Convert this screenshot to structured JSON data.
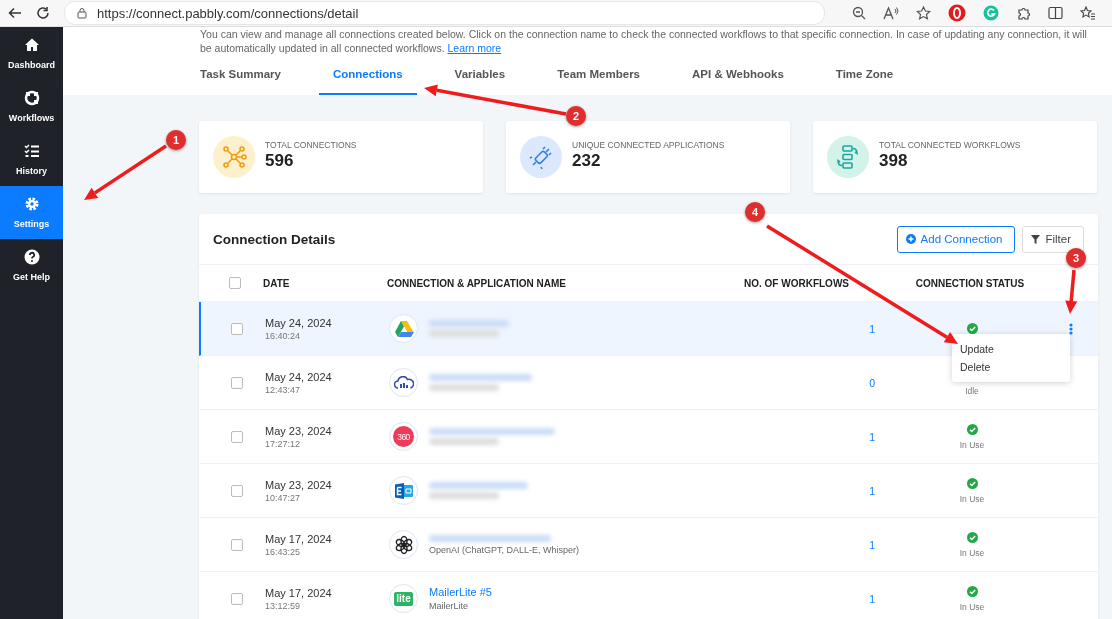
{
  "browser": {
    "url": "https://connect.pabbly.com/connections/detail"
  },
  "sidebar": {
    "items": [
      {
        "label": "Dashboard",
        "selected": false
      },
      {
        "label": "Workflows",
        "selected": false
      },
      {
        "label": "History",
        "selected": false
      },
      {
        "label": "Settings",
        "selected": true
      },
      {
        "label": "Get Help",
        "selected": false
      }
    ]
  },
  "header": {
    "description": "You can view and manage all connections created below. Click on the connection name to check the connected workflows to that specific connection. In case of updating any connection, it will be automatically updated in all connected workflows.",
    "link": "Learn more"
  },
  "tabs": [
    {
      "label": "Task Summary",
      "selected": false
    },
    {
      "label": "Connections",
      "selected": true
    },
    {
      "label": "Variables",
      "selected": false
    },
    {
      "label": "Team Members",
      "selected": false
    },
    {
      "label": "API & Webhooks",
      "selected": false
    },
    {
      "label": "Time Zone",
      "selected": false
    }
  ],
  "stats": [
    {
      "label": "TOTAL CONNECTIONS",
      "value": "596",
      "color": "#fdf0cc"
    },
    {
      "label": "UNIQUE CONNECTED APPLICATIONS",
      "value": "232",
      "color": "#dbe8fd"
    },
    {
      "label": "TOTAL CONNECTED WORKFLOWS",
      "value": "398",
      "color": "#d3f3e9"
    }
  ],
  "table": {
    "title": "Connection Details",
    "buttons": [
      {
        "label": "Add Connection",
        "kind": "primary"
      },
      {
        "label": "Filter",
        "kind": "filter"
      }
    ],
    "header_checked": false,
    "columns": [
      "DATE",
      "CONNECTION & APPLICATION NAME",
      "NO. OF WORKFLOWS",
      "CONNECTION STATUS"
    ],
    "rows": [
      {
        "date": "May 24, 2024",
        "time": "16:40:24",
        "name_hidden": true,
        "workflows": "1",
        "status_check": true,
        "selected": true,
        "checked": false,
        "menu_open": true
      },
      {
        "date": "May 24, 2024",
        "time": "12:43:47",
        "name_hidden": true,
        "workflows": "0",
        "status_check": false,
        "status": "Idle",
        "selected": false,
        "checked": false,
        "menu_open": false
      },
      {
        "date": "May 23, 2024",
        "time": "17:27:12",
        "logo_text": "360",
        "name_hidden": true,
        "workflows": "1",
        "status_check": true,
        "status": "In Use",
        "selected": false,
        "checked": false,
        "menu_open": false
      },
      {
        "date": "May 23, 2024",
        "time": "10:47:27",
        "name_hidden": true,
        "workflows": "1",
        "status_check": true,
        "status": "In Use",
        "selected": false,
        "checked": false,
        "menu_open": false
      },
      {
        "date": "May 17, 2024",
        "time": "16:43:25",
        "name_hidden": true,
        "subtitle": "OpenAI (ChatGPT, DALL-E, Whisper)",
        "workflows": "1",
        "status_check": true,
        "status": "In Use",
        "selected": false,
        "checked": false,
        "menu_open": false
      },
      {
        "date": "May 17, 2024",
        "time": "13:12:59",
        "logo_text": "lite",
        "name_hidden": false,
        "name": "MailerLite #5",
        "subtitle": "MailerLite",
        "workflows": "1",
        "status_check": true,
        "status": "In Use",
        "selected": false,
        "checked": false,
        "menu_open": false
      }
    ]
  },
  "row_menu": {
    "items": [
      "Update",
      "Delete"
    ]
  },
  "annotations": [
    {
      "number": "1"
    },
    {
      "number": "2"
    },
    {
      "number": "3"
    },
    {
      "number": "4"
    }
  ]
}
